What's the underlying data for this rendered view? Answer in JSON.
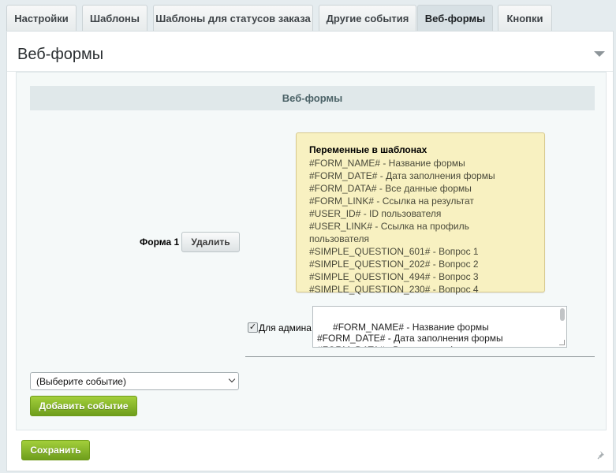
{
  "tabs": [
    "Настройки",
    "Шаблоны",
    "Шаблоны для статусов заказа",
    "Другие события",
    "Веб-формы",
    "Кнопки"
  ],
  "active_tab": "Веб-формы",
  "panel": {
    "title": "Веб-формы"
  },
  "section": {
    "header": "Веб-формы"
  },
  "form": {
    "label": "Форма 1",
    "delete_button": "Удалить"
  },
  "hint": {
    "title": "Переменные в шаблонах",
    "lines": [
      "#FORM_NAME# - Название формы",
      "#FORM_DATE# - Дата заполнения формы",
      "#FORM_DATA# - Все данные формы",
      "#FORM_LINK# - Ссылка на результат",
      "#USER_ID# - ID пользователя",
      "#USER_LINK# - Ссылка на профиль пользователя",
      "#SIMPLE_QUESTION_601# - Вопрос 1",
      "#SIMPLE_QUESTION_202# - Вопрос 2",
      "#SIMPLE_QUESTION_494# - Вопрос 3",
      "#SIMPLE_QUESTION_230# - Вопрос 4"
    ]
  },
  "admin": {
    "checkbox_label": "Для админа",
    "checked": true,
    "template_text": "#FORM_NAME# - Название формы\n#FORM_DATE# - Дата заполнения формы\n#FORM_DATA# - Все данные формы\n#FORM_LINK# - Ссылка на результат"
  },
  "event_select": {
    "value": "(Выберите событие)"
  },
  "add_event_button": "Добавить событие",
  "save_button": "Сохранить",
  "icons": {
    "collapse": "chevron-down-icon",
    "pin": "pin-icon",
    "check": "check-icon"
  },
  "colors": {
    "accent_green": "#8dbb2e",
    "hint_bg": "#f8f1c1",
    "active_tab_bg": "#d7e0e4"
  }
}
